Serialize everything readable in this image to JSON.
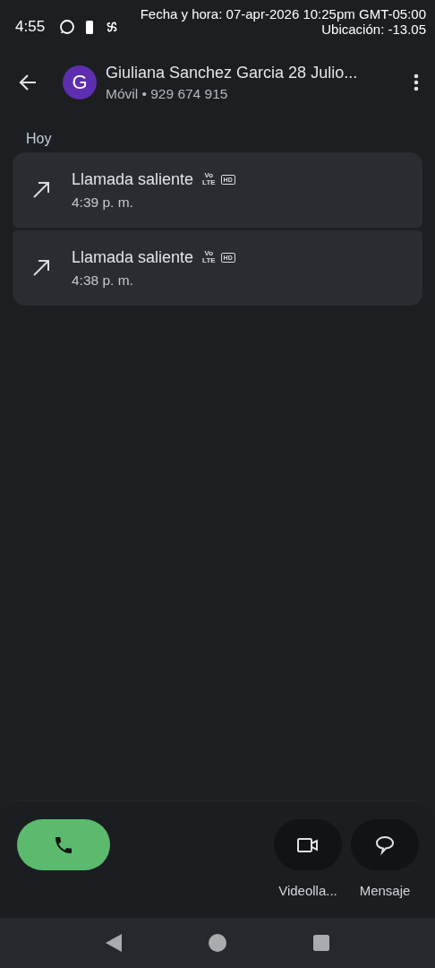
{
  "status_bar": {
    "time": "4:55",
    "stamp_lines": [
      "Fecha y hora: 07-apr-2026 10:25pm GMT-05:00",
      "Ubicación: -13.05"
    ]
  },
  "header": {
    "avatar_letter": "G",
    "name": "Giuliana Sanchez Garcia 28 Julio...",
    "subtitle": "Móvil • 929 674 915"
  },
  "section": "Hoy",
  "calls": [
    {
      "label": "Llamada saliente",
      "time": "4:39 p. m.",
      "volte": [
        "Vo",
        "LTE"
      ],
      "hd": "HD"
    },
    {
      "label": "Llamada saliente",
      "time": "4:38 p. m.",
      "volte": [
        "Vo",
        "LTE"
      ],
      "hd": "HD"
    }
  ],
  "actions": [
    {
      "kind": "call"
    },
    {
      "kind": "video",
      "label": "Videolla..."
    },
    {
      "kind": "message",
      "label": "Mensaje"
    }
  ]
}
